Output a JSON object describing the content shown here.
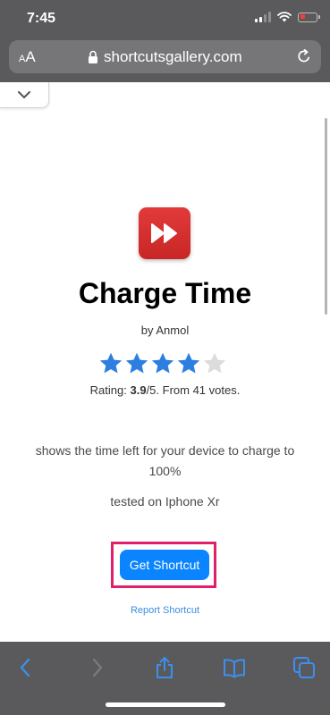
{
  "status_bar": {
    "time": "7:45",
    "signal_icon": "cellular-signal-icon",
    "wifi_icon": "wifi-icon",
    "battery_icon": "battery-low-icon"
  },
  "address_bar": {
    "text_size_label_small": "A",
    "text_size_label_large": "A",
    "lock_icon": "lock-icon",
    "url": "shortcutsgallery.com",
    "reload_icon": "reload-icon"
  },
  "page": {
    "collapse_icon": "chevron-down-icon",
    "app_icon": "fast-forward-icon",
    "title": "Charge Time",
    "author": "by Anmol",
    "rating": {
      "value": 3.9,
      "max": 5,
      "prefix": "Rating: ",
      "score": "3.9",
      "suffix": "/5. From 41 votes."
    },
    "description": "shows the time left for your device to charge to 100%",
    "tested": "tested on Iphone Xr",
    "get_button_label": "Get Shortcut",
    "report_link_label": "Report Shortcut"
  },
  "toolbar": {
    "back_icon": "back-arrow-icon",
    "forward_icon": "forward-arrow-icon",
    "share_icon": "share-icon",
    "bookmarks_icon": "bookmarks-icon",
    "tabs_icon": "tabs-icon"
  },
  "colors": {
    "accent": "#0a84ff",
    "star_filled": "#2c7fe0",
    "star_empty": "#dcdcdc",
    "highlight": "#e0206a",
    "app_icon_red": "#d32f2f",
    "chrome": "#5a5a5c"
  }
}
